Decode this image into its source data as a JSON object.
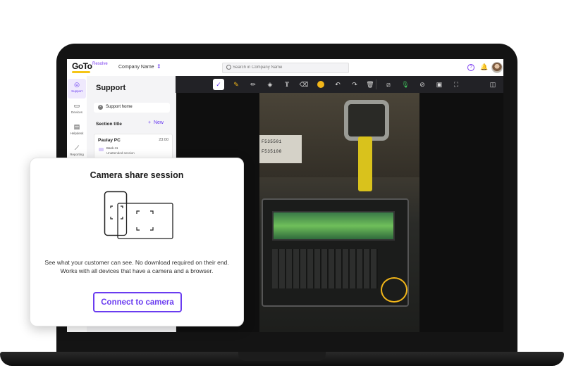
{
  "app": {
    "logo_text": "GoTo",
    "logo_sub": "Resolve",
    "company_name": "Company Name"
  },
  "search": {
    "placeholder": "Search in Company Name"
  },
  "rail": {
    "items": [
      {
        "label": "Support"
      },
      {
        "label": "Devices"
      },
      {
        "label": "Helpdesk"
      },
      {
        "label": "Reporting"
      }
    ]
  },
  "panel": {
    "title": "Support",
    "support_home": "Support home",
    "section_title": "Section title",
    "new_label": "New",
    "card": {
      "name": "Paulay PC",
      "time": "23:00",
      "sub1": "Bank-11",
      "sub2": "Unattended session"
    }
  },
  "toolbar": {
    "annotation_color": "#f2b619"
  },
  "video": {
    "label_1": "F535501",
    "label_2": "F535100"
  },
  "dialog": {
    "title": "Camera share session",
    "description_line1": "See what your customer can see. No download required on their end.",
    "description_line2": "Works with all devices that have a camera and a browser.",
    "button_label": "Connect to camera"
  },
  "colors": {
    "accent": "#6a3cf0",
    "logo_underline": "#f5c518"
  }
}
